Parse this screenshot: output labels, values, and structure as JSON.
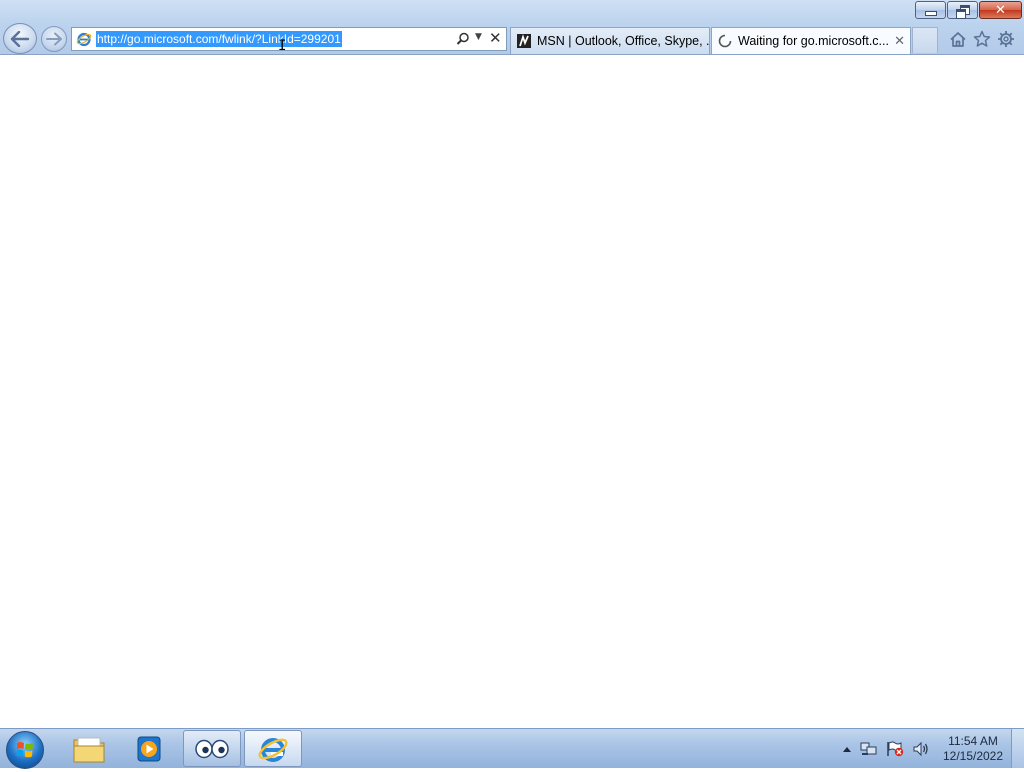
{
  "window": {
    "controls": {
      "minimize_icon": "minimize-icon",
      "maximize_icon": "restore-icon",
      "close_icon": "close-icon"
    }
  },
  "toolbar": {
    "back_icon": "back-arrow-icon",
    "forward_icon": "forward-arrow-icon",
    "address": {
      "value": "http://go.microsoft.com/fwlink/?LinkId=299201",
      "selected": true
    },
    "search_icon": "search-icon",
    "dropdown_icon": "dropdown-arrow-icon",
    "stop_icon": "stop-icon"
  },
  "tabs": [
    {
      "title": "MSN | Outlook, Office, Skype, ...",
      "favicon": "msn-icon",
      "active": false
    },
    {
      "title": "Waiting for go.microsoft.c...",
      "favicon": "loading-spinner-icon",
      "active": true,
      "close": "✕"
    }
  ],
  "command_icons": [
    "home-icon",
    "favorites-star-icon",
    "tools-gear-icon"
  ],
  "taskbar": {
    "start": "windows-start-orb",
    "items": [
      {
        "name": "windows-explorer",
        "icon": "folder-icon",
        "running": false
      },
      {
        "name": "windows-media-player",
        "icon": "media-player-icon",
        "running": false
      },
      {
        "name": "eyes-app",
        "icon": "eyes-icon",
        "running": true
      },
      {
        "name": "internet-explorer",
        "icon": "ie-icon",
        "running": true,
        "active": true
      }
    ],
    "tray": [
      "show-hidden-icons-arrow",
      "network-icon",
      "action-center-flag-icon",
      "volume-icon"
    ],
    "clock": {
      "time": "11:54 AM",
      "date": "12/15/2022"
    }
  },
  "colors": {
    "chrome_top": "#cfe0f4",
    "selection": "#3399ff",
    "close_button": "#c3371d",
    "taskbar": "#a9c4e6"
  }
}
